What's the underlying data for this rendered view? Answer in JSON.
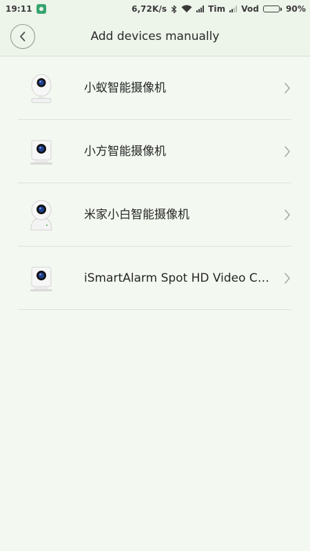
{
  "status_bar": {
    "time": "19:11",
    "network_speed": "6,72K/s",
    "carrier_1": "Tim",
    "carrier_2": "Vod",
    "battery": "90%",
    "battery_level": 0.9
  },
  "header": {
    "title": "Add devices manually",
    "back_icon": "chevron-left-icon"
  },
  "devices": [
    {
      "label": "小蚁智能摄像机",
      "icon": "dome-camera-icon"
    },
    {
      "label": "小方智能摄像机",
      "icon": "cube-camera-icon"
    },
    {
      "label": "米家小白智能摄像机",
      "icon": "ptz-camera-icon"
    },
    {
      "label": "iSmartAlarm Spot HD Video Ca…",
      "icon": "cube-camera-icon"
    }
  ],
  "colors": {
    "background": "#f3f9f0",
    "header": "#edf4ea",
    "lens": "#1f3f8a"
  }
}
